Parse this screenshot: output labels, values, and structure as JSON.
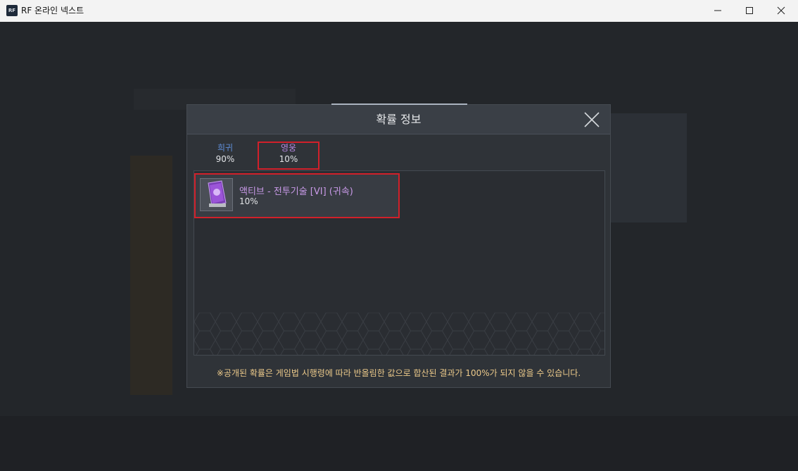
{
  "window": {
    "icon_text": "RF",
    "title": "RF 온라인 넥스트",
    "controls": [
      "minimize",
      "maximize",
      "close"
    ]
  },
  "popup": {
    "title": "확률 정보",
    "tabs": [
      {
        "label": "희귀",
        "value": "90%",
        "color": "#5f8ed8"
      },
      {
        "label": "영웅",
        "value": "10%",
        "color": "#b587df",
        "selected": true
      }
    ],
    "items": [
      {
        "name": "액티브 - 전투기술 [VI] (귀속)",
        "probability": "10%",
        "icon": "skill-book-icon"
      }
    ],
    "notice": "※공개된 확률은 게임법 시행령에 따라 반올림한 값으로 합산된 결과가 100%가 되지 않을 수 있습니다."
  },
  "colors": {
    "highlight_border": "#d1202a",
    "notice_text": "#ebc98a"
  }
}
